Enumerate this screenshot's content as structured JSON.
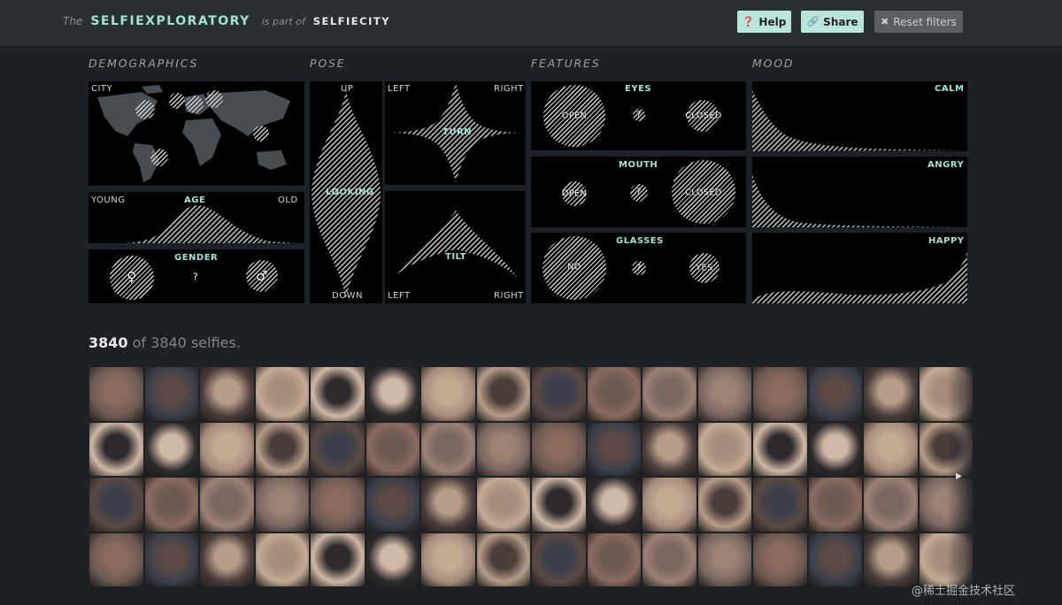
{
  "header": {
    "prefix": "The",
    "title": "SELFIEXPLORATORY",
    "connector": "is part of",
    "site": "SELFIECITY",
    "help_label": "Help",
    "share_label": "Share",
    "reset_label": "Reset filters"
  },
  "sections": {
    "demographics": "DEMOGRAPHICS",
    "pose": "POSE",
    "features": "FEATURES",
    "mood": "MOOD"
  },
  "demographics": {
    "city_label": "CITY",
    "age_label": "AGE",
    "age_min": "YOUNG",
    "age_max": "OLD",
    "gender_label": "GENDER",
    "female_symbol": "♀",
    "unknown_symbol": "?",
    "male_symbol": "♂"
  },
  "pose": {
    "up": "UP",
    "looking": "LOOKING",
    "down": "DOWN",
    "left": "LEFT",
    "right": "RIGHT",
    "turn": "TURN",
    "tilt": "TILT"
  },
  "features": {
    "eyes": {
      "label": "EYES",
      "a": "OPEN",
      "q": "?",
      "b": "CLOSED"
    },
    "mouth": {
      "label": "MOUTH",
      "a": "OPEN",
      "q": "?",
      "b": "CLOSED"
    },
    "glasses": {
      "label": "GLASSES",
      "a": "NO",
      "q": "?",
      "b": "YES"
    }
  },
  "mood": {
    "calm": "CALM",
    "angry": "ANGRY",
    "happy": "HAPPY"
  },
  "results": {
    "shown": "3840",
    "rest": "of 3840 selfies."
  },
  "gallery_next_icon": "chevron-right-icon",
  "watermark": "@稀土掘金技术社区",
  "colors": {
    "accent": "#a3e2d4",
    "background": "#1d2025",
    "panel": "#000000"
  }
}
